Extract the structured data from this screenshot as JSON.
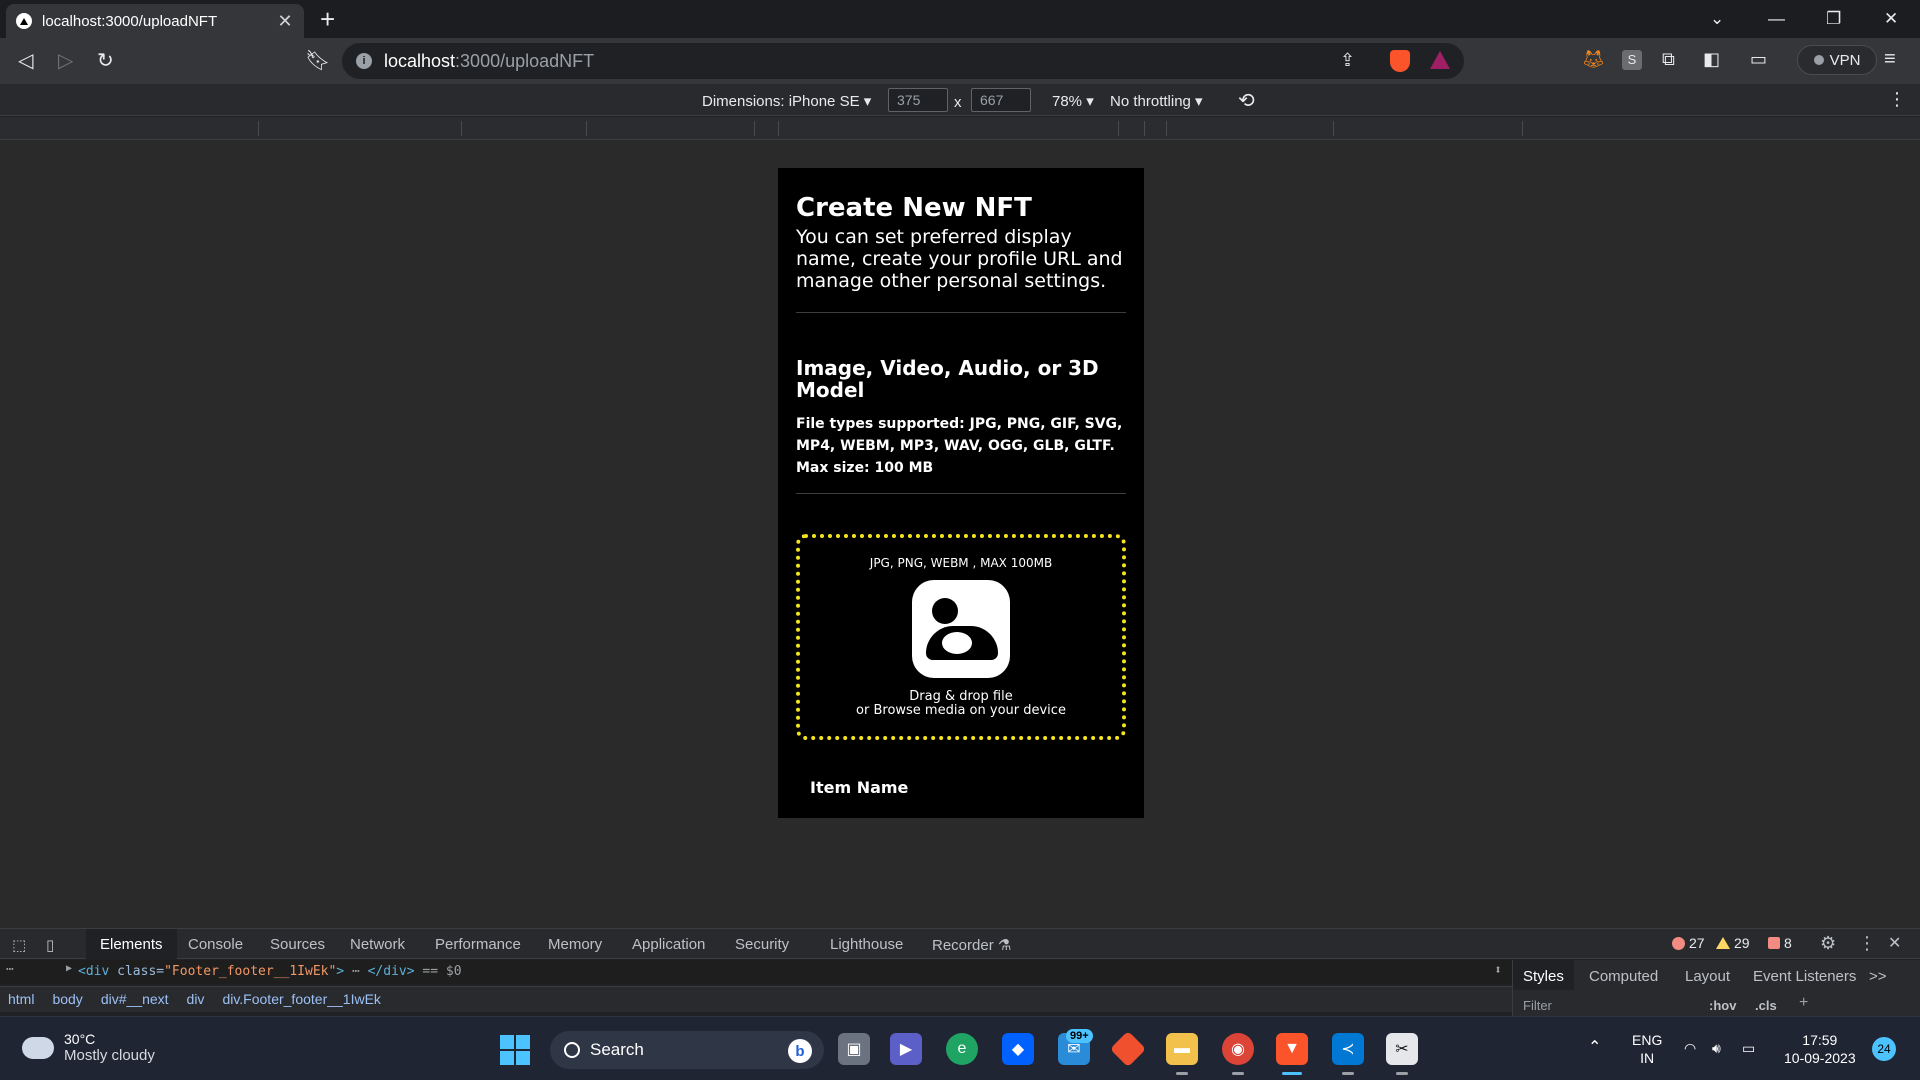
{
  "browser": {
    "tab_title": "localhost:3000/uploadNFT",
    "url_host": "localhost",
    "url_path": ":3000/uploadNFT",
    "vpn_label": "VPN"
  },
  "device_toolbar": {
    "dimensions_label": "Dimensions: iPhone SE",
    "width": "375",
    "height": "667",
    "times": "x",
    "zoom": "78%",
    "throttling": "No throttling"
  },
  "page": {
    "title": "Create New NFT",
    "subtitle": "You can set preferred display name, create your profile URL and manage other personal settings.",
    "media_heading": "Image, Video, Audio, or 3D Model",
    "file_types": "File types supported: JPG, PNG, GIF, SVG, MP4, WEBM, MP3, WAV, OGG, GLB, GLTF. Max size: 100 MB",
    "dropzone_hint": "JPG, PNG, WEBM , MAX 100MB",
    "dropzone_line1": "Drag & drop file",
    "dropzone_line2": "or Browse media on your device",
    "item_name_label": "Item Name"
  },
  "devtools": {
    "tabs": [
      "Elements",
      "Console",
      "Sources",
      "Network",
      "Performance",
      "Memory",
      "Application",
      "Security",
      "Lighthouse",
      "Recorder"
    ],
    "errors": "27",
    "warnings": "29",
    "issues": "8",
    "dom_tag_open": "<div",
    "dom_attr": "class=",
    "dom_val": "\"Footer_footer__1IwEk\"",
    "dom_gt": ">",
    "dom_ellipsis": "⋯",
    "dom_tag_close": "</div>",
    "dom_suffix": "== $0",
    "breadcrumbs": [
      "html",
      "body",
      "div#__next",
      "div",
      "div.Footer_footer__1IwEk"
    ],
    "style_tabs": [
      "Styles",
      "Computed",
      "Layout",
      "Event Listeners"
    ],
    "more_tabs": ">>",
    "filter_placeholder": "Filter",
    "hov": ":hov",
    "cls": ".cls"
  },
  "taskbar": {
    "temperature": "30°C",
    "weather": "Mostly cloudy",
    "search_label": "Search",
    "bing": "b",
    "mail_badge": "99+",
    "lang1": "ENG",
    "lang2": "IN",
    "time": "17:59",
    "date": "10-09-2023",
    "notifications": "24"
  },
  "colors": {
    "dropzone_border": "#f5e51f",
    "accent": "#4cc2ff"
  }
}
